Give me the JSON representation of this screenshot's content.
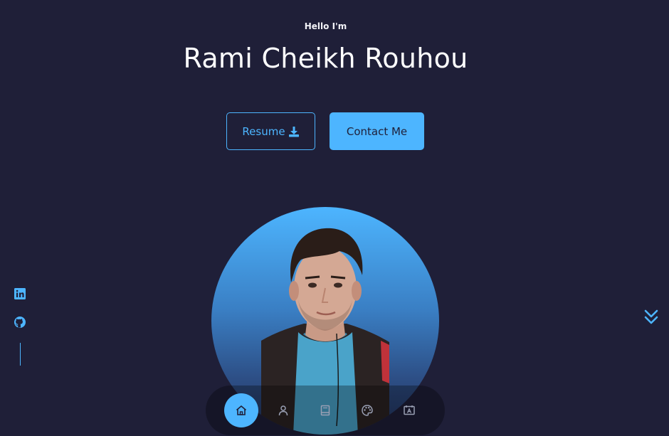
{
  "header": {
    "greeting": "Hello I'm",
    "name": "Rami Cheikh Rouhou"
  },
  "buttons": {
    "resume_label": "Resume",
    "contact_label": "Contact Me"
  },
  "socials": [
    {
      "icon": "linkedin-icon"
    },
    {
      "icon": "github-icon"
    }
  ],
  "nav": [
    {
      "icon": "home-icon",
      "active": true
    },
    {
      "icon": "user-icon",
      "active": false
    },
    {
      "icon": "book-icon",
      "active": false
    },
    {
      "icon": "palette-icon",
      "active": false
    },
    {
      "icon": "contact-card-icon",
      "active": false
    }
  ],
  "colors": {
    "background": "#1f1f38",
    "accent": "#4db5ff",
    "text": "#ffffff"
  }
}
